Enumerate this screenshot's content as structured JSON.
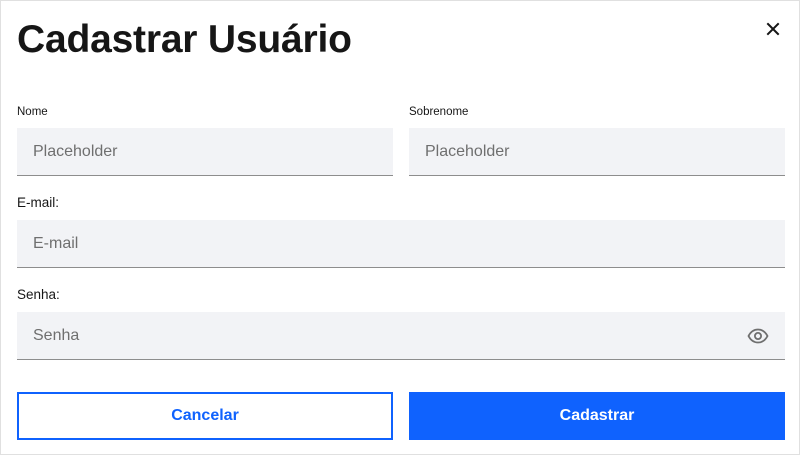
{
  "dialog": {
    "title": "Cadastrar Usuário",
    "close_icon": "close-icon"
  },
  "form": {
    "first_name": {
      "label": "Nome",
      "placeholder": "Placeholder",
      "value": ""
    },
    "last_name": {
      "label": "Sobrenome",
      "placeholder": "Placeholder",
      "value": ""
    },
    "email": {
      "label": "E-mail:",
      "placeholder": "E-mail",
      "value": ""
    },
    "password": {
      "label": "Senha:",
      "placeholder": "Senha",
      "value": "",
      "toggle_icon": "eye-icon"
    }
  },
  "actions": {
    "cancel_label": "Cancelar",
    "submit_label": "Cadastrar"
  },
  "colors": {
    "primary": "#0f62fe",
    "field_bg": "#f2f3f6",
    "text": "#161616",
    "placeholder": "#6f6f6f"
  }
}
